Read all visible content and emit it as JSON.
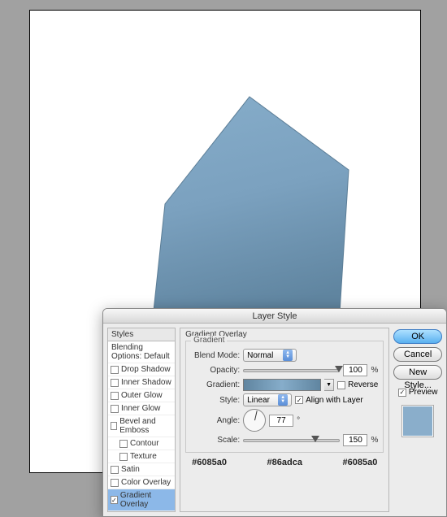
{
  "dialog": {
    "title": "Layer Style",
    "styles_header": "Styles",
    "blending_options": "Blending Options: Default",
    "items": [
      {
        "label": "Drop Shadow",
        "checked": false
      },
      {
        "label": "Inner Shadow",
        "checked": false
      },
      {
        "label": "Outer Glow",
        "checked": false
      },
      {
        "label": "Inner Glow",
        "checked": false
      },
      {
        "label": "Bevel and Emboss",
        "checked": false
      },
      {
        "label": "Contour",
        "checked": false,
        "indent": true
      },
      {
        "label": "Texture",
        "checked": false,
        "indent": true
      },
      {
        "label": "Satin",
        "checked": false
      },
      {
        "label": "Color Overlay",
        "checked": false
      },
      {
        "label": "Gradient Overlay",
        "checked": true,
        "selected": true
      }
    ],
    "panel": {
      "group_title": "Gradient Overlay",
      "legend": "Gradient",
      "blend_mode": {
        "label": "Blend Mode:",
        "value": "Normal"
      },
      "opacity": {
        "label": "Opacity:",
        "value": "100",
        "unit": "%"
      },
      "gradient": {
        "label": "Gradient:",
        "reverse_label": "Reverse",
        "reverse_checked": false
      },
      "style": {
        "label": "Style:",
        "value": "Linear",
        "align_label": "Align with Layer",
        "align_checked": true
      },
      "angle": {
        "label": "Angle:",
        "value": "77",
        "unit": "°"
      },
      "scale": {
        "label": "Scale:",
        "value": "150",
        "unit": "%"
      },
      "hex1": "#6085a0",
      "hex2": "#86adca",
      "hex3": "#6085a0"
    },
    "buttons": {
      "ok": "OK",
      "cancel": "Cancel",
      "new_style": "New Style..."
    },
    "preview": {
      "label": "Preview",
      "checked": true
    }
  }
}
